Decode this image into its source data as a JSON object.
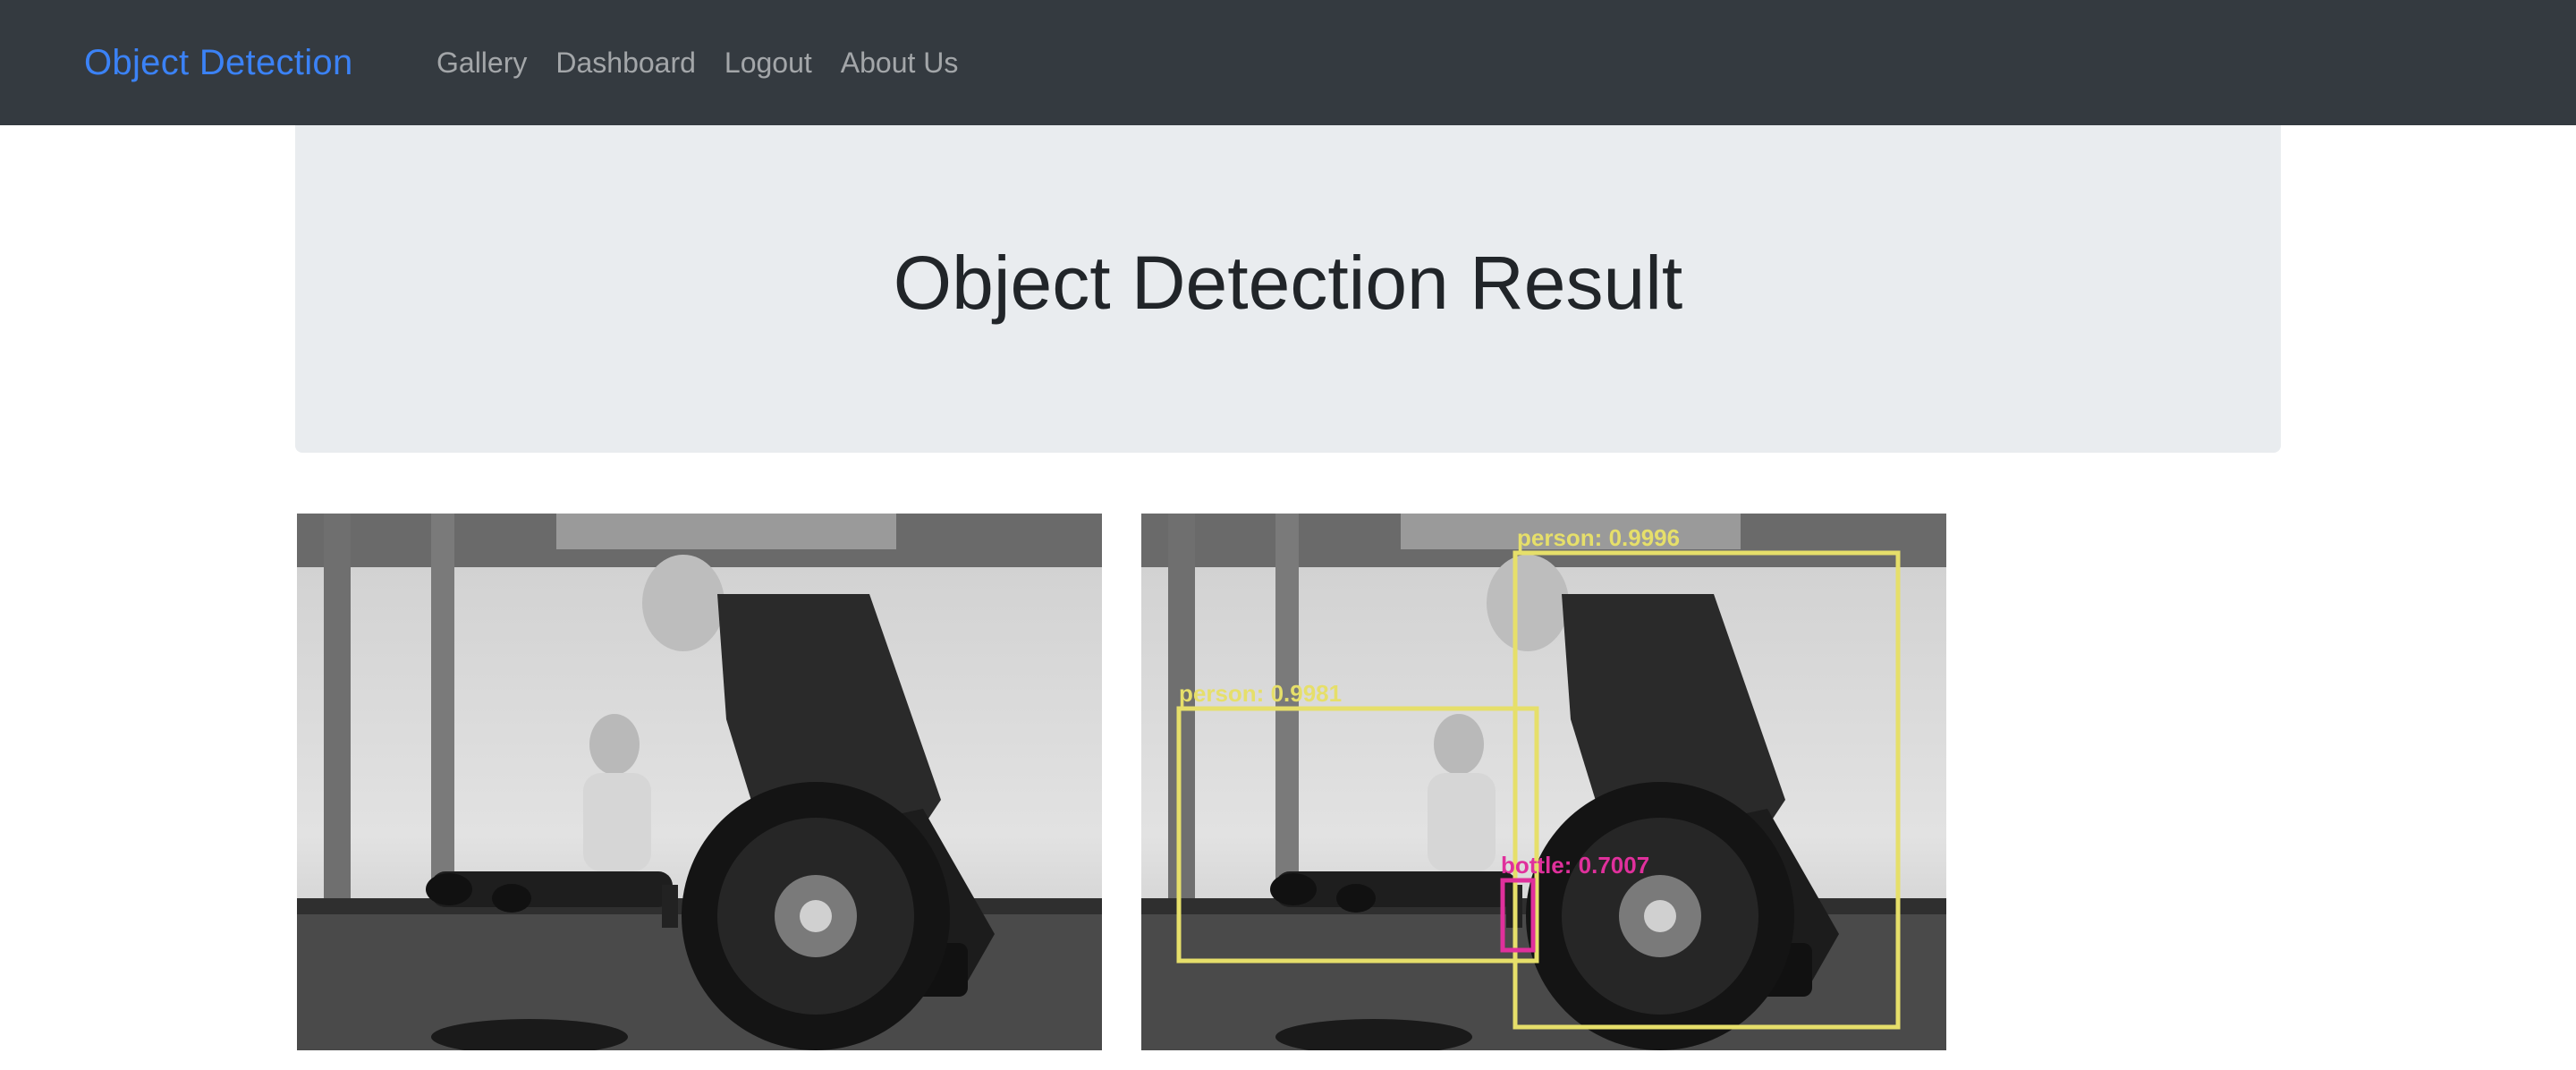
{
  "navbar": {
    "brand": "Object Detection",
    "links": [
      "Gallery",
      "Dashboard",
      "Logout",
      "About Us"
    ]
  },
  "page": {
    "title": "Object Detection Result"
  },
  "detections": [
    {
      "label": "person:  0.9996",
      "color": "#e6df6a"
    },
    {
      "label": "person:  0.9981",
      "color": "#e6df6a"
    },
    {
      "label": "bottle:  0.7007",
      "color": "#e0309c"
    }
  ],
  "colors": {
    "nav_bg": "#343a40",
    "brand": "#3b82f6",
    "jumbotron_bg": "#e9ecef"
  }
}
